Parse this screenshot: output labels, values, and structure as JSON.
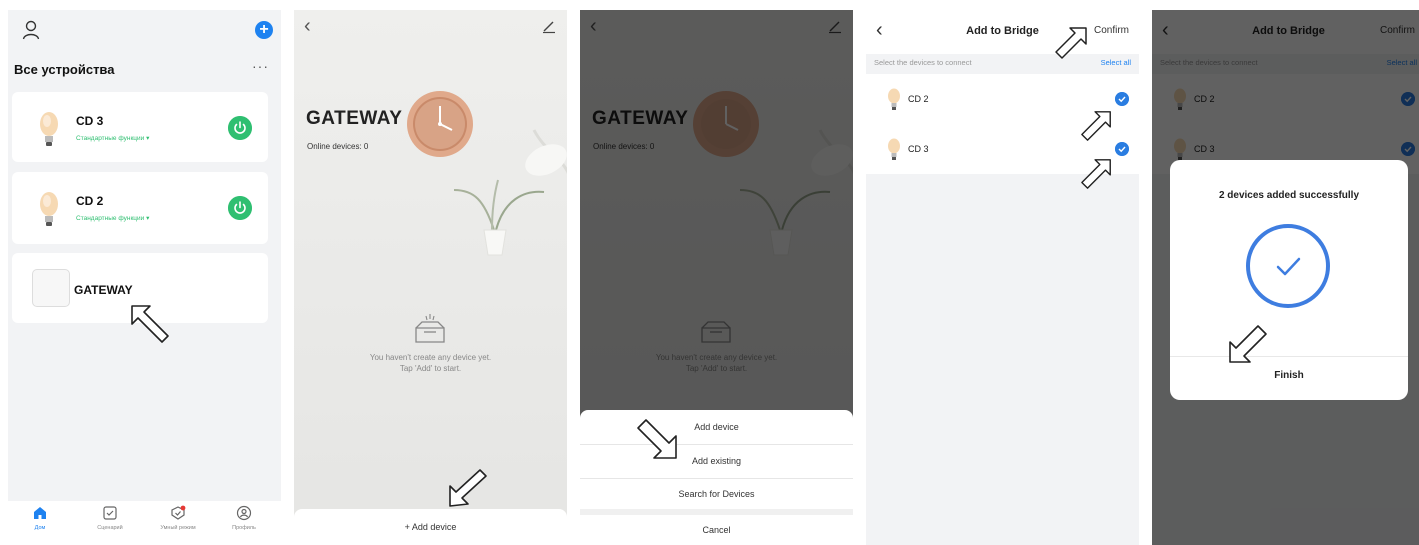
{
  "home": {
    "title": "Все устройства",
    "more": "···",
    "devices": [
      {
        "name": "CD 3",
        "sub": "Стандартные функции ▾"
      },
      {
        "name": "CD 2",
        "sub": "Стандартные функции ▾"
      }
    ],
    "gateway_name": "GATEWAY",
    "tabs": [
      {
        "label": "Дом"
      },
      {
        "label": "Сценарий"
      },
      {
        "label": "Умный режим"
      },
      {
        "label": "Профиль"
      }
    ]
  },
  "gateway": {
    "title": "GATEWAY",
    "online": "Online devices: 0",
    "empty_line1": "You haven't create any device yet.",
    "empty_line2": "Tap 'Add' to start.",
    "add_button": "+  Add device",
    "sheet": {
      "add_device": "Add device",
      "add_existing": "Add existing",
      "search": "Search for Devices",
      "cancel": "Cancel"
    }
  },
  "bridge": {
    "title": "Add to Bridge",
    "confirm": "Confirm",
    "subtitle": "Select the devices to connect",
    "select_all": "Select all",
    "rows": [
      {
        "name": "CD 2"
      },
      {
        "name": "CD 3"
      }
    ]
  },
  "success": {
    "message": "2 devices added successfully",
    "finish": "Finish"
  },
  "colors": {
    "accent": "#1e82f0",
    "power_green": "#2fbf71",
    "check_blue": "#2a7de1",
    "ring_blue": "#3e7de0"
  }
}
